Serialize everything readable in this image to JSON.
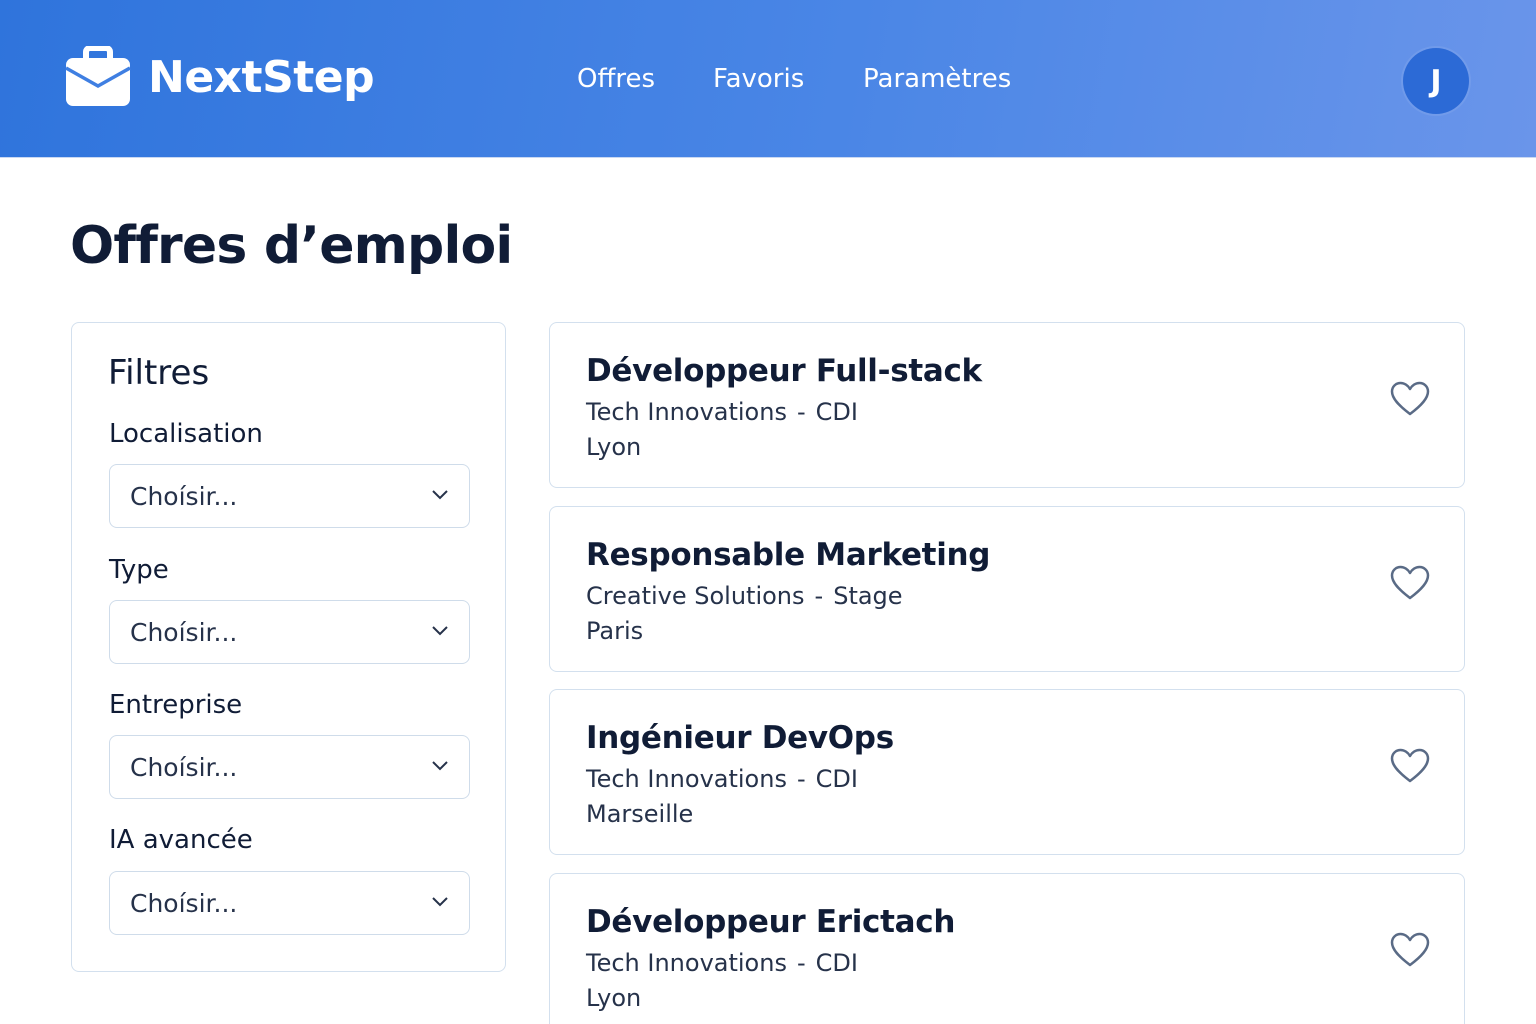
{
  "header": {
    "brand_name": "NextStep",
    "brand_icon": "briefcase-icon",
    "nav": [
      {
        "label": "Offres"
      },
      {
        "label": "Favoris"
      },
      {
        "label": "Paramètres"
      }
    ],
    "avatar_initial": "J"
  },
  "page": {
    "title": "Offres d’emploi"
  },
  "filters": {
    "title": "Filtres",
    "fields": [
      {
        "label": "Localisation",
        "value": "Choísir..."
      },
      {
        "label": "Type",
        "value": "Choísir..."
      },
      {
        "label": "Entreprise",
        "value": "Choísir..."
      },
      {
        "label": "IA avancée",
        "value": "Choísir..."
      }
    ],
    "select_icon": "chevron-down-icon"
  },
  "jobs": [
    {
      "title": "Développeur Full-stack",
      "company": "Tech Innovations",
      "separator": "-",
      "contract": "CDI",
      "location": "Lyon",
      "favorite_icon": "heart-outline-icon"
    },
    {
      "title": "Responsable Marketing",
      "company": "Creative Solutions",
      "separator": "-",
      "contract": "Stage",
      "location": "Paris",
      "favorite_icon": "heart-outline-icon"
    },
    {
      "title": "Ingénieur DevOps",
      "company": "Tech Innovations",
      "separator": "-",
      "contract": "CDI",
      "location": "Marseille",
      "favorite_icon": "heart-outline-icon"
    },
    {
      "title": "Développeur Erictach",
      "company": "Tech Innovations",
      "separator": "-",
      "contract": "CDI",
      "location": "Lyon",
      "favorite_icon": "heart-outline-icon"
    }
  ],
  "colors": {
    "header_gradient_start": "#2f74dc",
    "header_gradient_end": "#6a95ea",
    "avatar_bg": "#2c6ad6",
    "text_dark": "#101c36",
    "border": "#d3e0ee",
    "heart_stroke": "#5a6b86"
  }
}
